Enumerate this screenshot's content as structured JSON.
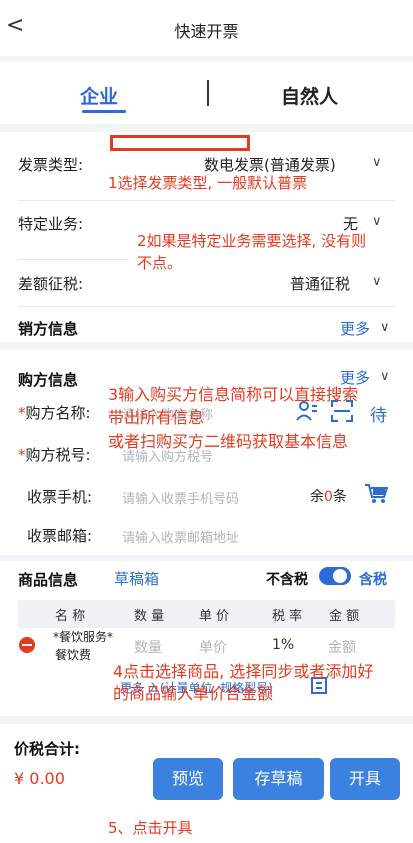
{
  "header": {
    "back": "<",
    "title": "快速开票"
  },
  "tabs": {
    "enterprise": "企业",
    "natural": "自然人"
  },
  "invoice": {
    "type_label": "发票类型:",
    "type_value": "数电发票(普通发票)",
    "special_label": "特定业务:",
    "special_value": "无",
    "diff_label": "差额征税:",
    "diff_value": "普通征税"
  },
  "seller": {
    "title": "销方信息",
    "more": "更多"
  },
  "buyer": {
    "title": "购方信息",
    "more": "更多",
    "name_label": "购方名称:",
    "name_ph": "请输入购方名称",
    "tax_label": "购方税号:",
    "tax_ph": "请输入购方税号",
    "phone_label": "收票手机:",
    "phone_ph": "请输入收票手机号码",
    "quota_prefix": "余",
    "quota_num": "0",
    "quota_suffix": "条",
    "email_label": "收票邮箱:",
    "email_ph": "请输入收票邮箱地址",
    "waiting": "待"
  },
  "goods": {
    "title": "商品信息",
    "draft": "草稿箱",
    "tax_toggle_off": "不含税",
    "tax_toggle_on": "含税",
    "headers": [
      "名 称",
      "数 量",
      "单 价",
      "税 率",
      "金 额"
    ],
    "row": {
      "name1": "*餐饮服务*",
      "name2": "餐饮费",
      "qty": "数量",
      "price": "单价",
      "rate": "1%",
      "amount": "金额"
    },
    "more_hint": "更多 入(计量单位, 规格型号)"
  },
  "total": {
    "label": "价税合计:",
    "amount": "¥ 0.00"
  },
  "buttons": {
    "preview": "预览",
    "save": "存草稿",
    "issue": "开具"
  },
  "annotations": {
    "a1": "1选择发票类型, 一般默认普票",
    "a2_1": "2如果是特定业务需要选择, 没有则",
    "a2_2": "不点。",
    "a3_1": "3输入购买方信息简称可以直接搜索",
    "a3_2": "带出所有信息",
    "a3_3": "或者扫购买方二维码获取基本信息",
    "a4_1": "4点击选择商品, 选择同步或者添加好",
    "a4_2": "的商品输入单价合金额",
    "a5": "5、点击开具"
  },
  "colors": {
    "accent": "#2a6bd4",
    "button": "#3b82e0",
    "annotation": "#e53a1f",
    "delete": "#e53a1f"
  }
}
